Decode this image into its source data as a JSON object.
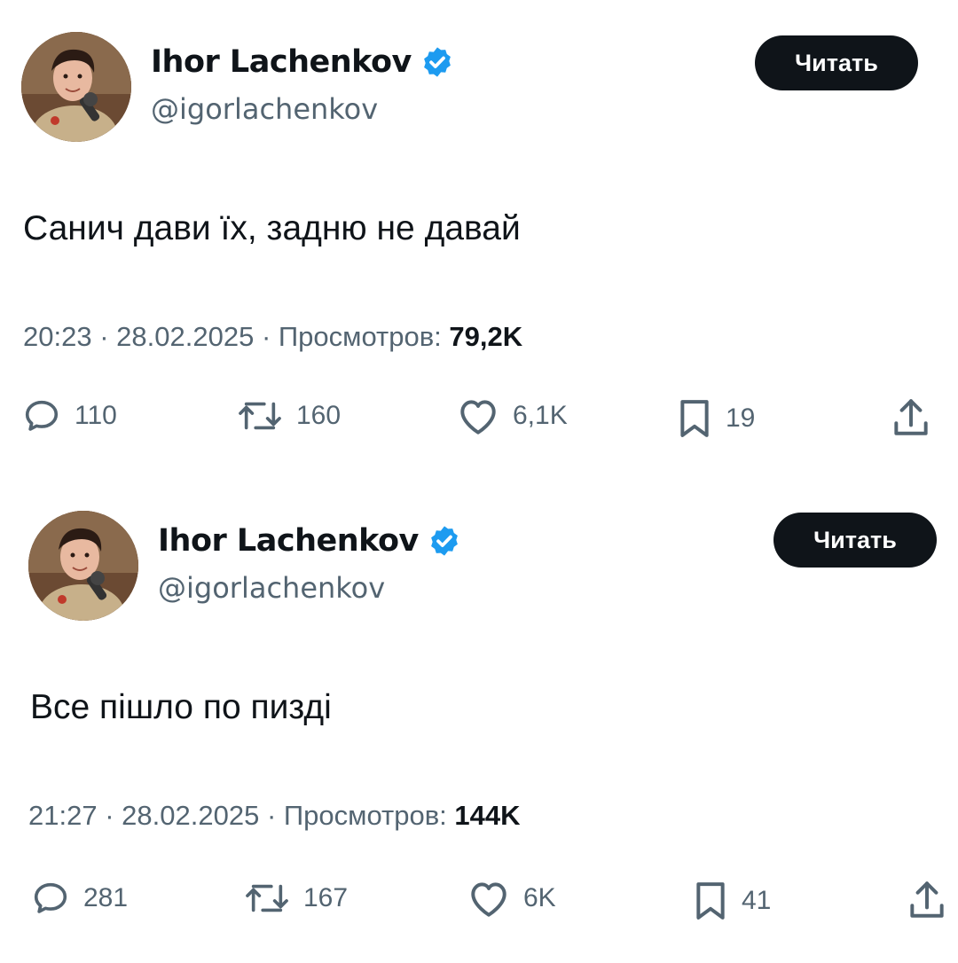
{
  "colors": {
    "text_primary": "#0f1419",
    "text_secondary": "#536471",
    "verified_badge": "#1d9bf0",
    "button_bg": "#0f1419",
    "button_text": "#ffffff"
  },
  "tweets": [
    {
      "author": {
        "display_name": "Ihor Lachenkov",
        "handle": "@igorlachenkov",
        "verified": true
      },
      "follow_label": "Читать",
      "text": "Санич дави їх, задню не давай",
      "time": "20:23",
      "date": "28.02.2025",
      "views_label": "Просмотров:",
      "views": "79,2K",
      "separator": "·",
      "actions": {
        "replies": "110",
        "retweets": "160",
        "likes": "6,1K",
        "bookmarks": "19"
      },
      "icons": [
        "reply-icon",
        "retweet-icon",
        "like-icon",
        "bookmark-icon",
        "share-icon"
      ]
    },
    {
      "author": {
        "display_name": "Ihor Lachenkov",
        "handle": "@igorlachenkov",
        "verified": true
      },
      "follow_label": "Читать",
      "text": "Все пішло по пизді",
      "time": "21:27",
      "date": "28.02.2025",
      "views_label": "Просмотров:",
      "views": "144K",
      "separator": "·",
      "actions": {
        "replies": "281",
        "retweets": "167",
        "likes": "6K",
        "bookmarks": "41"
      },
      "icons": [
        "reply-icon",
        "retweet-icon",
        "like-icon",
        "bookmark-icon",
        "share-icon"
      ]
    }
  ]
}
